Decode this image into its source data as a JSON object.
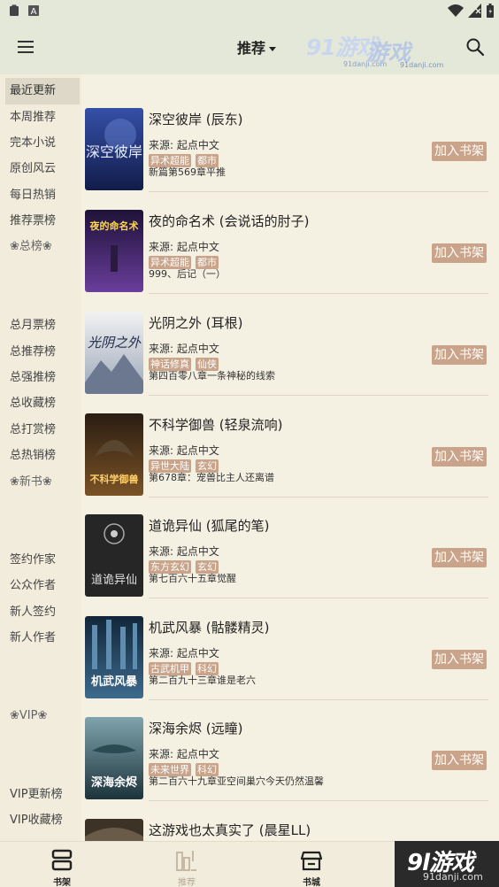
{
  "header": {
    "title": "推荐",
    "watermark_1": "91游戏",
    "watermark_1_sub": "91danji.com",
    "watermark_2": "游戏",
    "watermark_2_sub": "91danji.com"
  },
  "sidebar": {
    "items": [
      {
        "label": "最近更新",
        "active": true
      },
      {
        "label": "本周推荐"
      },
      {
        "label": "完本小说"
      },
      {
        "label": "原创风云"
      },
      {
        "label": "每日热销"
      },
      {
        "label": "推荐票榜"
      },
      {
        "label": "❀总榜❀",
        "section": true
      },
      {
        "label": "总月票榜"
      },
      {
        "label": "总推荐榜"
      },
      {
        "label": "总强推榜"
      },
      {
        "label": "总收藏榜"
      },
      {
        "label": "总打赏榜"
      },
      {
        "label": "总热销榜"
      },
      {
        "label": "❀新书❀",
        "section": true
      },
      {
        "label": "签约作家"
      },
      {
        "label": "公众作者"
      },
      {
        "label": "新人签约"
      },
      {
        "label": "新人作者"
      },
      {
        "label": "❀VIP❀",
        "section": true
      },
      {
        "label": "VIP更新榜"
      },
      {
        "label": "VIP收藏榜"
      }
    ]
  },
  "list": {
    "add_label": "加入书架",
    "books": [
      {
        "title": "深空彼岸 (辰东)",
        "source": "来源: 起点中文",
        "tags": [
          "异术超能",
          "都市"
        ],
        "latest": "新篇第569章平推",
        "cover_text": "深空彼岸",
        "cover_color": "#1c2a6b"
      },
      {
        "title": "夜的命名术 (会说话的肘子)",
        "source": "来源: 起点中文",
        "tags": [
          "异术超能",
          "都市"
        ],
        "latest": "999、后记（一）",
        "cover_text": "夜的命名术",
        "cover_color": "#3a2a5c"
      },
      {
        "title": "光阴之外 (耳根)",
        "source": "来源: 起点中文",
        "tags": [
          "神话修真",
          "仙侠"
        ],
        "latest": "第四百零八章一条神秘的线索",
        "cover_text": "光阴之外",
        "cover_color": "#d8dde6"
      },
      {
        "title": "不科学御兽 (轻泉流响)",
        "source": "来源: 起点中文",
        "tags": [
          "异世大陆",
          "玄幻"
        ],
        "latest": "第678章：宠兽比主人还离谱",
        "cover_text": "不科学御兽",
        "cover_color": "#4a3520"
      },
      {
        "title": "道诡异仙 (狐尾的笔)",
        "source": "来源: 起点中文",
        "tags": [
          "东方玄幻",
          "玄幻"
        ],
        "latest": "第七百六十五章觉醒",
        "cover_text": "道诡异仙",
        "cover_color": "#2b2b2b"
      },
      {
        "title": "机武风暴 (骷髅精灵)",
        "source": "来源: 起点中文",
        "tags": [
          "古武机甲",
          "科幻"
        ],
        "latest": "第二百九十三章谁是老六",
        "cover_text": "机武风暴",
        "cover_color": "#1d3550"
      },
      {
        "title": "深海余烬 (远瞳)",
        "source": "来源: 起点中文",
        "tags": [
          "未来世界",
          "科幻"
        ],
        "latest": "第二百六十九章亚空间巢穴今天仍然温馨",
        "cover_text": "深海余烬",
        "cover_color": "#2c4b55"
      },
      {
        "title": "这游戏也太真实了 (晨星LL)",
        "source": "",
        "tags": [],
        "latest": "",
        "cover_text": "",
        "cover_color": "#3d3226"
      }
    ]
  },
  "bottom_nav": {
    "items": [
      {
        "label": "书架"
      },
      {
        "label": "推荐"
      },
      {
        "label": "书城"
      }
    ]
  },
  "bottom_watermark": {
    "text": "9l游戏",
    "sub": "91danji.com"
  }
}
